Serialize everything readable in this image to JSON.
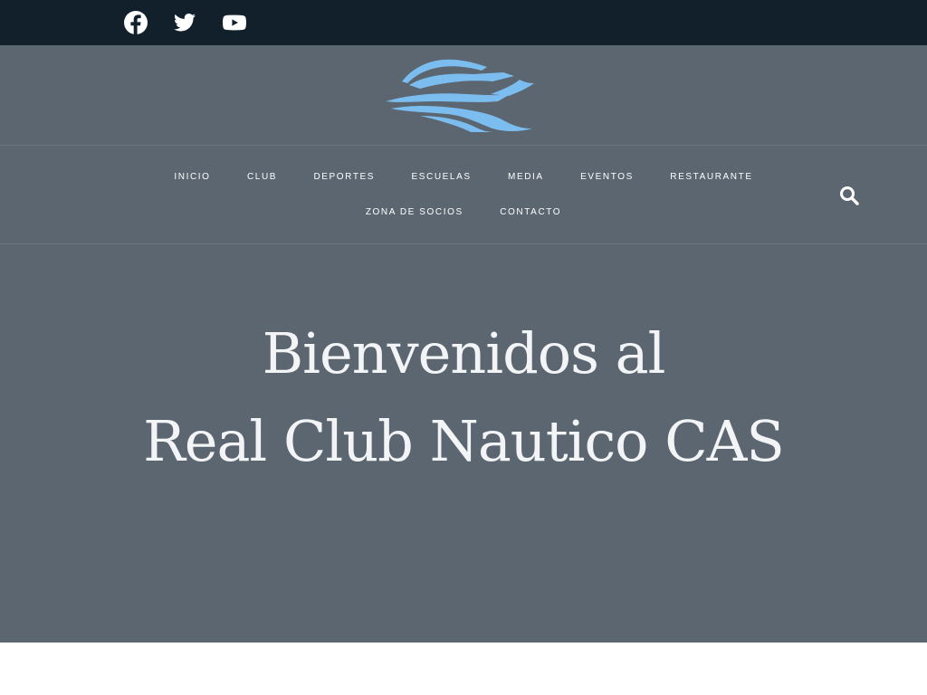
{
  "colors": {
    "topbar_bg": "#11202b",
    "header_bg": "#5b6670",
    "logo_color": "#7cbdf0",
    "text_color": "#ffffff"
  },
  "social": [
    {
      "name": "facebook",
      "icon": "facebook-icon"
    },
    {
      "name": "twitter",
      "icon": "twitter-icon"
    },
    {
      "name": "youtube",
      "icon": "youtube-icon"
    }
  ],
  "logo": {
    "icon": "boat-logo-icon"
  },
  "nav": {
    "items": [
      {
        "label": "INICIO"
      },
      {
        "label": "CLUB"
      },
      {
        "label": "DEPORTES"
      },
      {
        "label": "ESCUELAS"
      },
      {
        "label": "MEDIA"
      },
      {
        "label": "EVENTOS"
      },
      {
        "label": "RESTAURANTE"
      },
      {
        "label": "ZONA DE SOCIOS"
      },
      {
        "label": "CONTACTO"
      }
    ],
    "search_icon": "search-icon"
  },
  "hero": {
    "line1": "Bienvenidos al",
    "line2": "Real Club Nautico CAS"
  }
}
